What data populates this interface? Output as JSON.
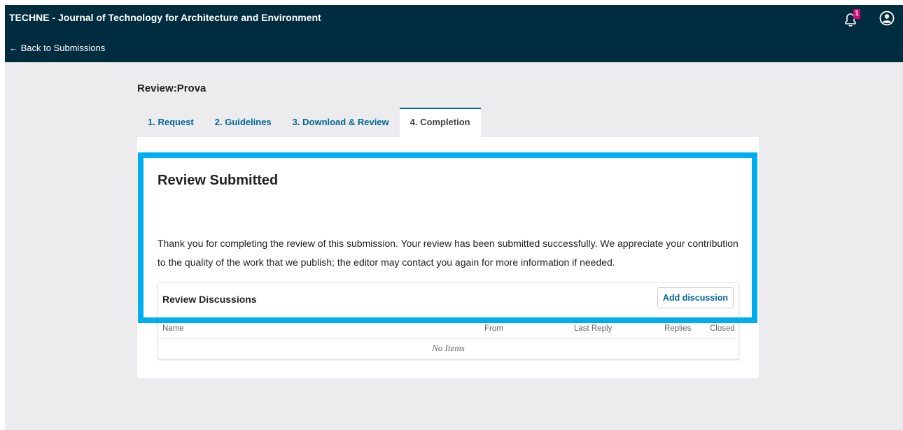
{
  "header": {
    "app_title": "TECHNE - Journal of Technology for Architecture and Environment",
    "back_link": "← Back to Submissions",
    "notification_count": "1",
    "icons": [
      "bell-icon",
      "user-account-icon"
    ],
    "background_color": "#002c40",
    "badge_color": "#d00a6c"
  },
  "page": {
    "title": "Review:Prova"
  },
  "tabs": [
    {
      "label": "1. Request"
    },
    {
      "label": "2. Guidelines"
    },
    {
      "label": "3. Download & Review"
    },
    {
      "label": "4. Completion",
      "active": true
    }
  ],
  "completion": {
    "heading": "Review Submitted",
    "message": "Thank you for completing the review of this submission. Your review has been submitted successfully. We appreciate your contribution to the quality of the work that we publish; the editor may contact you again for more information if needed."
  },
  "discussions": {
    "title": "Review Discussions",
    "add_button": "Add discussion",
    "columns": [
      "Name",
      "From",
      "Last Reply",
      "Replies",
      "Closed"
    ],
    "empty_text": "No Items"
  },
  "colors": {
    "accent": "#006798",
    "highlight_border": "#00aeef"
  }
}
